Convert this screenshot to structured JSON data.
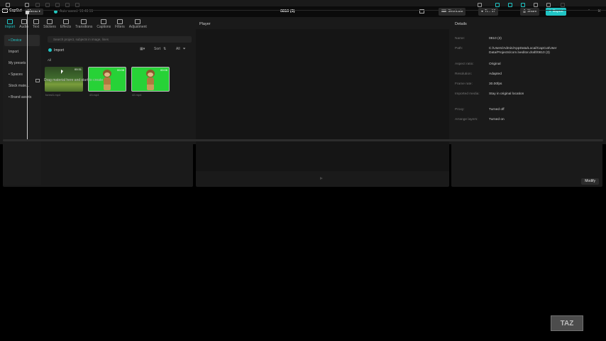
{
  "titlebar": {
    "app_name": "CapCut",
    "menu_label": "Menu",
    "autosave_text": "Auto saved: 16:48:55",
    "project_title": "0810 (3)",
    "shortcuts_label": "Shortcuts",
    "user_label": "Ti... 17",
    "share_label": "Share",
    "export_label": "Export"
  },
  "toolbar": {
    "tabs": [
      {
        "label": "Import",
        "icon": "import-icon"
      },
      {
        "label": "Audio",
        "icon": "audio-icon"
      },
      {
        "label": "Text",
        "icon": "text-icon"
      },
      {
        "label": "Stickers",
        "icon": "stickers-icon"
      },
      {
        "label": "Effects",
        "icon": "effects-icon"
      },
      {
        "label": "Transitions",
        "icon": "transitions-icon"
      },
      {
        "label": "Captions",
        "icon": "captions-icon"
      },
      {
        "label": "Filters",
        "icon": "filters-icon"
      },
      {
        "label": "Adjustment",
        "icon": "adjustment-icon"
      }
    ]
  },
  "sidebar": {
    "items": [
      {
        "label": "• Device"
      },
      {
        "label": "Import"
      },
      {
        "label": "My presets"
      },
      {
        "label": "• Spaces"
      },
      {
        "label": "Stock mate..."
      },
      {
        "label": "• Brand assets"
      }
    ]
  },
  "media": {
    "search_placeholder": "Search project, subjects in image, lines",
    "import_label": "Import",
    "sort_label": "Sort",
    "all_filter_label": "All",
    "section_label": "All",
    "items": [
      {
        "name": "forest1.mp4",
        "duration": "00:31"
      },
      {
        "name": "43.mp4",
        "duration": "00:08"
      },
      {
        "name": "42.mp4",
        "duration": "00:06"
      }
    ]
  },
  "player": {
    "title": "Player"
  },
  "details": {
    "title": "Details",
    "rows": [
      {
        "key": "Name:",
        "value": "0810 (3)"
      },
      {
        "key": "Path:",
        "value": "C:/Users/Admin/AppData/Local/CapCut/User Data/Projects/com.lveditor.draft/0810 (3)"
      },
      {
        "key": "Aspect ratio:",
        "value": "Original"
      },
      {
        "key": "Resolution:",
        "value": "Adapted"
      },
      {
        "key": "Frame rate:",
        "value": "30.00fps"
      },
      {
        "key": "Imported media:",
        "value": "Stay in original location"
      },
      {
        "key": "Proxy:",
        "value": "Turned off"
      },
      {
        "key": "Arrange layers:",
        "value": "Turned on"
      }
    ],
    "modify_label": "Modify"
  },
  "timeline": {
    "drag_hint": "Drag material here and start to create"
  },
  "watermark": "TAZ",
  "colors": {
    "accent": "#20c5c5",
    "panel_bg": "#1a1a1a",
    "green_screen": "#27d237"
  }
}
